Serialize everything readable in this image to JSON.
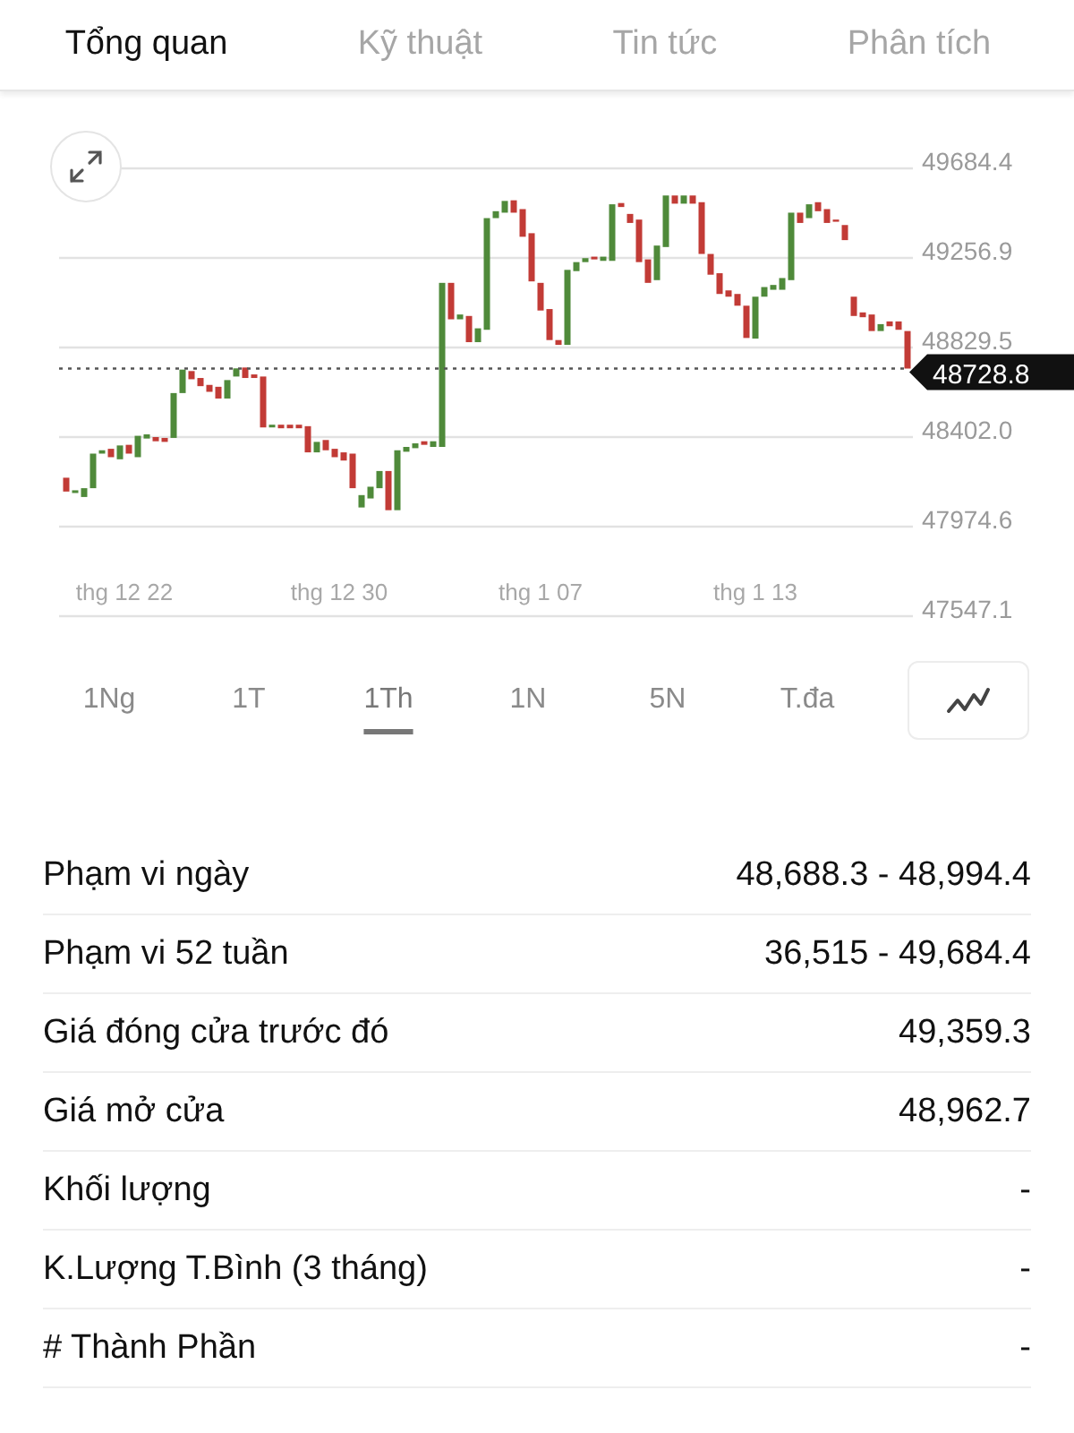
{
  "tabs": [
    {
      "label": "Tổng quan",
      "selected": true
    },
    {
      "label": "Kỹ thuật",
      "selected": false
    },
    {
      "label": "Tin tức",
      "selected": false
    },
    {
      "label": "Phân tích",
      "selected": false
    }
  ],
  "chart": {
    "price_labels": [
      "49684.4",
      "49256.9",
      "48829.5",
      "48402.0",
      "47974.6",
      "47547.1"
    ],
    "date_labels": [
      "thg 12 22",
      "thg 12 30",
      "thg 1 07",
      "thg 1 13"
    ],
    "last_price": "48728.8"
  },
  "ranges": [
    {
      "label": "1Ng",
      "selected": false
    },
    {
      "label": "1T",
      "selected": false
    },
    {
      "label": "1Th",
      "selected": true
    },
    {
      "label": "1N",
      "selected": false
    },
    {
      "label": "5N",
      "selected": false
    },
    {
      "label": "T.đa",
      "selected": false
    }
  ],
  "stats": [
    {
      "label": "Phạm vi ngày",
      "value": "48,688.3 - 48,994.4"
    },
    {
      "label": "Phạm vi 52 tuần",
      "value": "36,515 - 49,684.4"
    },
    {
      "label": "Giá đóng cửa trước đó",
      "value": "49,359.3"
    },
    {
      "label": "Giá mở cửa",
      "value": "48,962.7"
    },
    {
      "label": "Khối lượng",
      "value": "-"
    },
    {
      "label": "K.Lượng T.Bình (3 tháng)",
      "value": "-"
    },
    {
      "label": "# Thành Phần",
      "value": "-"
    }
  ]
}
